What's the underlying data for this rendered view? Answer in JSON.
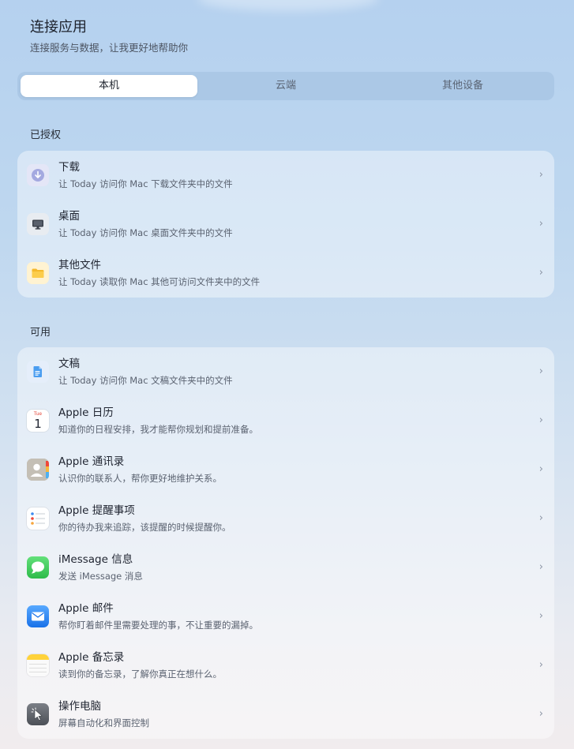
{
  "header": {
    "title": "连接应用",
    "subtitle": "连接服务与数据，让我更好地帮助你"
  },
  "tabs": [
    {
      "label": "本机",
      "active": true
    },
    {
      "label": "云端",
      "active": false
    },
    {
      "label": "其他设备",
      "active": false
    }
  ],
  "sections": {
    "authorized_label": "已授权",
    "available_label": "可用"
  },
  "authorized": [
    {
      "title": "下载",
      "desc": "让 Today 访问你 Mac 下载文件夹中的文件",
      "icon": "download-icon"
    },
    {
      "title": "桌面",
      "desc": "让 Today 访问你 Mac 桌面文件夹中的文件",
      "icon": "desktop-icon"
    },
    {
      "title": "其他文件",
      "desc": "让 Today 读取你 Mac 其他可访问文件夹中的文件",
      "icon": "folder-icon"
    }
  ],
  "available": [
    {
      "title": "文稿",
      "desc": "让 Today 访问你 Mac 文稿文件夹中的文件",
      "icon": "document-icon"
    },
    {
      "title": "Apple 日历",
      "desc": "知道你的日程安排，我才能帮你规划和提前准备。",
      "icon": "calendar-icon"
    },
    {
      "title": "Apple 通讯录",
      "desc": "认识你的联系人，帮你更好地维护关系。",
      "icon": "contacts-icon"
    },
    {
      "title": "Apple 提醒事项",
      "desc": "你的待办我来追踪，该提醒的时候提醒你。",
      "icon": "reminders-icon"
    },
    {
      "title": "iMessage 信息",
      "desc": "发送 iMessage 消息",
      "icon": "messages-icon"
    },
    {
      "title": "Apple 邮件",
      "desc": "帮你盯着邮件里需要处理的事，不让重要的漏掉。",
      "icon": "mail-icon"
    },
    {
      "title": "Apple 备忘录",
      "desc": "读到你的备忘录，了解你真正在想什么。",
      "icon": "notes-icon"
    },
    {
      "title": "操作电脑",
      "desc": "屏幕自动化和界面控制",
      "icon": "cursor-icon"
    }
  ],
  "calendar_icon": {
    "month": "Tue",
    "day": "1"
  },
  "chevron": "›",
  "colors": {
    "background_top": "#b5d1ef",
    "background_bottom": "#f1ecee",
    "tab_track": "#a7c4e3",
    "accent_blue": "#1971e8",
    "messages_green": "#2dbb4a",
    "notes_yellow": "#ffd23a"
  }
}
